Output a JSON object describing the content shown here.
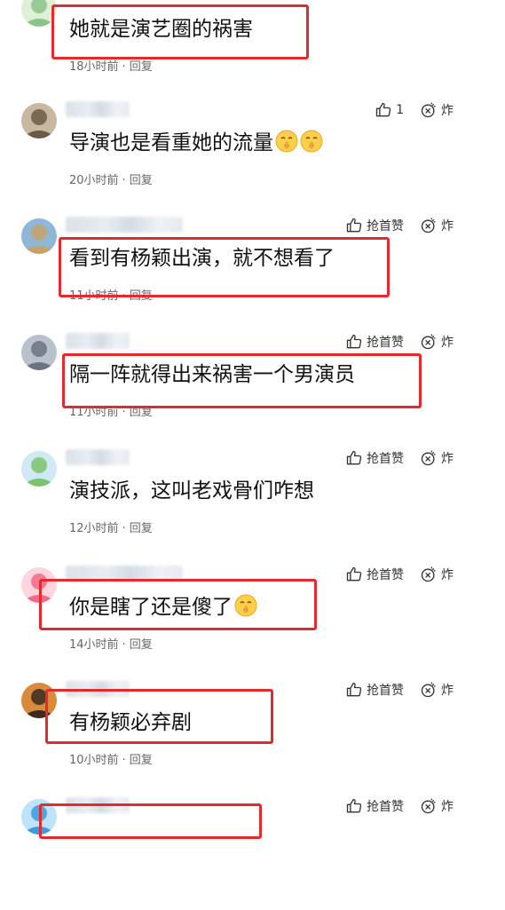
{
  "comments": [
    {
      "text": "她就是演艺圈的祸害",
      "emojis": 0,
      "time": "18小时前",
      "reply": "回复",
      "like": "",
      "bomb": "",
      "avatar_colors": [
        "#8bc48a",
        "#dff0d8"
      ],
      "highlighted": true
    },
    {
      "text": "导演也是看重她的流量",
      "emojis": 2,
      "time": "20小时前",
      "reply": "回复",
      "like": "1",
      "bomb": "炸",
      "avatar_colors": [
        "#6b5a48",
        "#c8b8a0"
      ],
      "highlighted": false
    },
    {
      "text": "看到有杨颖出演，就不想看了",
      "emojis": 0,
      "time": "11小时前",
      "reply": "回复",
      "like": "抢首赞",
      "bomb": "炸",
      "avatar_colors": [
        "#c7a36a",
        "#8fb7d8"
      ],
      "highlighted": true
    },
    {
      "text": "隔一阵就得出来祸害一个男演员",
      "emojis": 0,
      "time": "11小时前",
      "reply": "回复",
      "like": "抢首赞",
      "bomb": "炸",
      "avatar_colors": [
        "#6a7480",
        "#b9c2cc"
      ],
      "highlighted": true
    },
    {
      "text": "演技派，这叫老戏骨们咋想",
      "emojis": 0,
      "time": "12小时前",
      "reply": "回复",
      "like": "抢首赞",
      "bomb": "炸",
      "avatar_colors": [
        "#7dc36b",
        "#cfe9f6"
      ],
      "highlighted": false
    },
    {
      "text": "你是瞎了还是傻了",
      "emojis": 1,
      "time": "14小时前",
      "reply": "回复",
      "like": "抢首赞",
      "bomb": "炸",
      "avatar_colors": [
        "#f26a8a",
        "#ffd6e0"
      ],
      "highlighted": true
    },
    {
      "text": "有杨颖必弃剧",
      "emojis": 0,
      "time": "10小时前",
      "reply": "回复",
      "like": "抢首赞",
      "bomb": "炸",
      "avatar_colors": [
        "#3a2a20",
        "#d98a3a"
      ],
      "highlighted": true
    },
    {
      "text": "",
      "emojis": 0,
      "time": "",
      "reply": "",
      "like": "抢首赞",
      "bomb": "炸",
      "avatar_colors": [
        "#3a9be0",
        "#bfe3fa"
      ],
      "highlighted": true
    }
  ],
  "separator": "·",
  "colors": {
    "highlight": "#e32a2f",
    "text": "#111111",
    "meta": "#666666"
  },
  "icons": {
    "like": "thumbs-up-icon",
    "bomb": "bomb-icon",
    "emoji": "shushing-face-emoji"
  }
}
